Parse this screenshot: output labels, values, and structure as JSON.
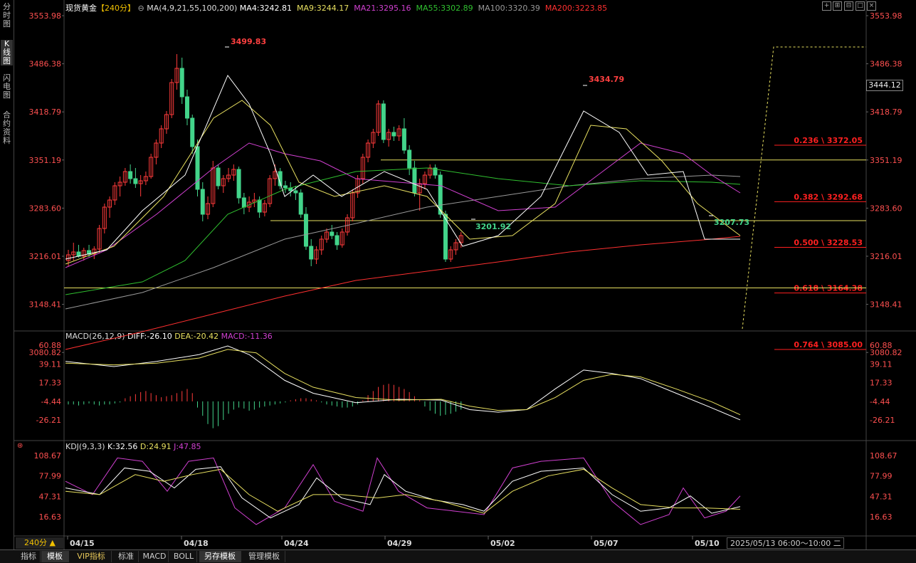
{
  "header": {
    "instrument": "现货黄金",
    "period_tag": "【240分】",
    "ma_params": "MA(4,9,21,55,100,200)",
    "ma4": "MA4:3242.81",
    "ma9": "MA9:3244.17",
    "ma21": "MA21:3295.16",
    "ma55": "MA55:3302.89",
    "ma100": "MA100:3320.39",
    "ma200": "MA200:3223.85"
  },
  "colors": {
    "up": "#ff3b3b",
    "down": "#43d48a",
    "ma4": "#ffffff",
    "ma9": "#e8e060",
    "ma21": "#d040d0",
    "ma55": "#30c030",
    "ma100": "#999999",
    "ma200": "#ff3030",
    "fib": "#ff2020",
    "hline": "#e8e060",
    "axis_left": "#ff5050",
    "axis_right": "#ff5050"
  },
  "sidebar": {
    "items": [
      "分时图",
      "K线图",
      "闪电图",
      "合约资料"
    ]
  },
  "price_axis": {
    "labels": [
      "3553.98",
      "3486.38",
      "3418.79",
      "3351.19",
      "3283.60",
      "3216.01",
      "3148.41",
      "3080.82"
    ],
    "current_price": "3444.12"
  },
  "annotations": {
    "high1": "3499.83",
    "high2": "3434.79",
    "low1": "3201.92",
    "low2": "3207.73"
  },
  "fib_levels": [
    {
      "label": "0.236 \\ 3372.05",
      "price": 3372.05
    },
    {
      "label": "0.382 \\ 3292.68",
      "price": 3292.68
    },
    {
      "label": "0.500 \\ 3228.53",
      "price": 3228.53
    },
    {
      "label": "0.618 \\ 3164.38",
      "price": 3164.38
    },
    {
      "label": "0.764 \\ 3085.00",
      "price": 3085.0
    }
  ],
  "macd": {
    "title": "MACD(26,12,9)",
    "diff": "DIFF:-26.10",
    "dea": "DEA:-20.42",
    "macd": "MACD:-11.36",
    "axis_labels": [
      "60.88",
      "39.11",
      "17.33",
      "-4.44",
      "-26.21"
    ]
  },
  "kdj": {
    "title": "KDJ(9,3,3)",
    "k": "K:32.56",
    "d": "D:24.91",
    "j": "J:47.85",
    "axis_labels": [
      "108.67",
      "77.99",
      "47.31",
      "16.63"
    ]
  },
  "date_axis": {
    "labels": [
      "04/15",
      "04/18",
      "04/24",
      "04/29",
      "05/02",
      "05/07",
      "05/10"
    ]
  },
  "period_button": "240分 ▲",
  "time_tooltip": "2025/05/13 06:00～10:00 二",
  "bottom_tabs": [
    "指标",
    "模板",
    "VIP指标",
    "标准",
    "MACD",
    "BOLL",
    "另存模板",
    "管理模板"
  ],
  "toolbar_icons": [
    "crosshair-icon",
    "zoom-in-icon",
    "zoom-out-icon",
    "expand-icon",
    "close-icon"
  ]
}
